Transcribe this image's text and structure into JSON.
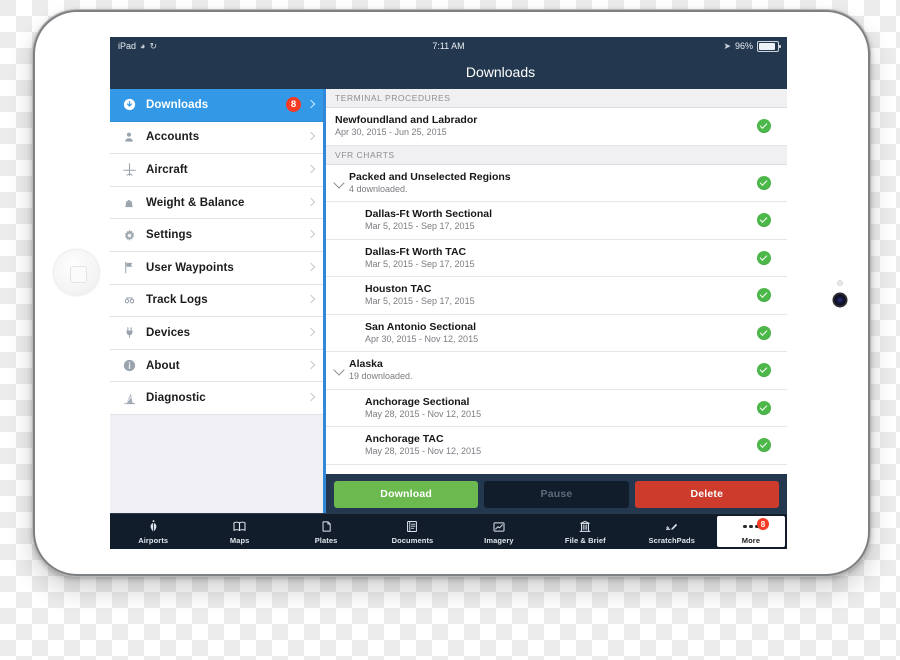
{
  "device": {
    "name": "iPad"
  },
  "statusbar": {
    "device_label": "iPad",
    "icons": [
      "rotation-lock-icon",
      "sync-icon"
    ],
    "time": "7:11 AM",
    "battery_percent": "96%",
    "location_icon": "location-arrow-icon"
  },
  "navbar": {
    "title": "Downloads"
  },
  "sidebar": {
    "items": [
      {
        "label": "Downloads",
        "icon": "download-circle-icon",
        "badge": "8",
        "selected": true
      },
      {
        "label": "Accounts",
        "icon": "person-icon",
        "badge": "",
        "selected": false
      },
      {
        "label": "Aircraft",
        "icon": "airplane-icon",
        "badge": "",
        "selected": false
      },
      {
        "label": "Weight & Balance",
        "icon": "weight-icon",
        "badge": "",
        "selected": false
      },
      {
        "label": "Settings",
        "icon": "gear-icon",
        "badge": "",
        "selected": false
      },
      {
        "label": "User Waypoints",
        "icon": "flag-icon",
        "badge": "",
        "selected": false
      },
      {
        "label": "Track Logs",
        "icon": "track-log-icon",
        "badge": "",
        "selected": false
      },
      {
        "label": "Devices",
        "icon": "plug-icon",
        "badge": "",
        "selected": false
      },
      {
        "label": "About",
        "icon": "info-icon",
        "badge": "",
        "selected": false
      },
      {
        "label": "Diagnostic",
        "icon": "diagnostic-icon",
        "badge": "",
        "selected": false
      }
    ]
  },
  "detail": {
    "sections": [
      {
        "header": "TERMINAL PROCEDURES",
        "rows": [
          {
            "level": "level0",
            "title": "Newfoundland and Labrador",
            "subtitle": "Apr 30, 2015 - Jun 25, 2015",
            "status": "downloaded"
          }
        ]
      },
      {
        "header": "VFR CHARTS",
        "rows": [
          {
            "level": "group",
            "title": "Packed and Unselected Regions",
            "subtitle": "4 downloaded.",
            "status": "downloaded",
            "expanded": true
          },
          {
            "level": "child",
            "title": "Dallas-Ft Worth Sectional",
            "subtitle": "Mar 5, 2015 - Sep 17, 2015",
            "status": "downloaded"
          },
          {
            "level": "child",
            "title": "Dallas-Ft Worth TAC",
            "subtitle": "Mar 5, 2015 - Sep 17, 2015",
            "status": "downloaded"
          },
          {
            "level": "child",
            "title": "Houston TAC",
            "subtitle": "Mar 5, 2015 - Sep 17, 2015",
            "status": "downloaded"
          },
          {
            "level": "child",
            "title": "San Antonio Sectional",
            "subtitle": "Apr 30, 2015 - Nov 12, 2015",
            "status": "downloaded"
          },
          {
            "level": "group",
            "title": "Alaska",
            "subtitle": "19 downloaded.",
            "status": "downloaded",
            "expanded": true
          },
          {
            "level": "child",
            "title": "Anchorage Sectional",
            "subtitle": "May 28, 2015 - Nov 12, 2015",
            "status": "downloaded"
          },
          {
            "level": "child",
            "title": "Anchorage TAC",
            "subtitle": "May 28, 2015 - Nov 12, 2015",
            "status": "downloaded"
          }
        ]
      }
    ]
  },
  "actions": {
    "download_label": "Download",
    "pause_label": "Pause",
    "delete_label": "Delete"
  },
  "tabbar": {
    "tabs": [
      {
        "label": "Airports",
        "icon": "windsock-icon",
        "active": false,
        "badge": ""
      },
      {
        "label": "Maps",
        "icon": "map-icon",
        "active": false,
        "badge": ""
      },
      {
        "label": "Plates",
        "icon": "plate-icon",
        "active": false,
        "badge": ""
      },
      {
        "label": "Documents",
        "icon": "document-icon",
        "active": false,
        "badge": ""
      },
      {
        "label": "Imagery",
        "icon": "chart-icon",
        "active": false,
        "badge": ""
      },
      {
        "label": "File & Brief",
        "icon": "building-icon",
        "active": false,
        "badge": ""
      },
      {
        "label": "ScratchPads",
        "icon": "pen-icon",
        "active": false,
        "badge": ""
      },
      {
        "label": "More",
        "icon": "ellipsis-icon",
        "active": true,
        "badge": "8"
      }
    ]
  },
  "colors": {
    "navy": "#23384f",
    "dark_navy": "#111d2b",
    "accent_blue": "#3399e6",
    "green": "#4cb849",
    "download_green": "#6cb94f",
    "delete_red": "#cc3b2c",
    "badge_red": "#f43b24"
  }
}
